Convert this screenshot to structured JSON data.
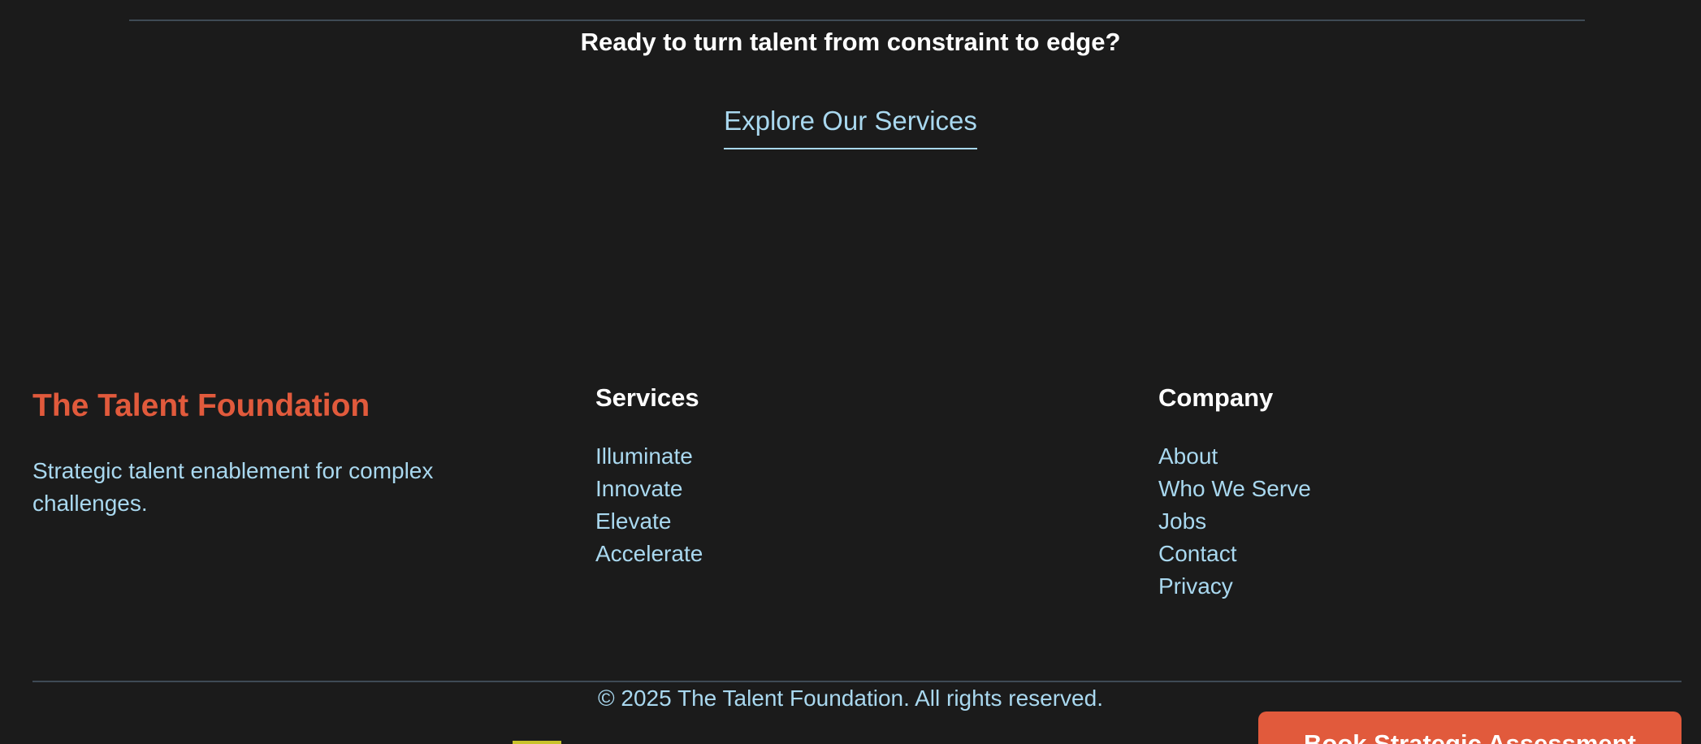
{
  "cta": {
    "heading": "Ready to turn talent from constraint to edge?",
    "link_label": "Explore Our Services"
  },
  "footer": {
    "brand": {
      "title": "The Talent Foundation",
      "tagline": "Strategic talent enablement for complex challenges."
    },
    "services": {
      "heading": "Services",
      "items": [
        "Illuminate",
        "Innovate",
        "Elevate",
        "Accelerate"
      ]
    },
    "company": {
      "heading": "Company",
      "items": [
        "About",
        "Who We Serve",
        "Jobs",
        "Contact",
        "Privacy"
      ]
    },
    "copyright": "© 2025 The Talent Foundation. All rights reserved."
  },
  "floating": {
    "book_label": "Book Strategic Assessment"
  },
  "colors": {
    "background": "#1b1b1b",
    "accent": "#e15a3c",
    "link": "#a9d8ef",
    "divider": "#3e4a55"
  }
}
